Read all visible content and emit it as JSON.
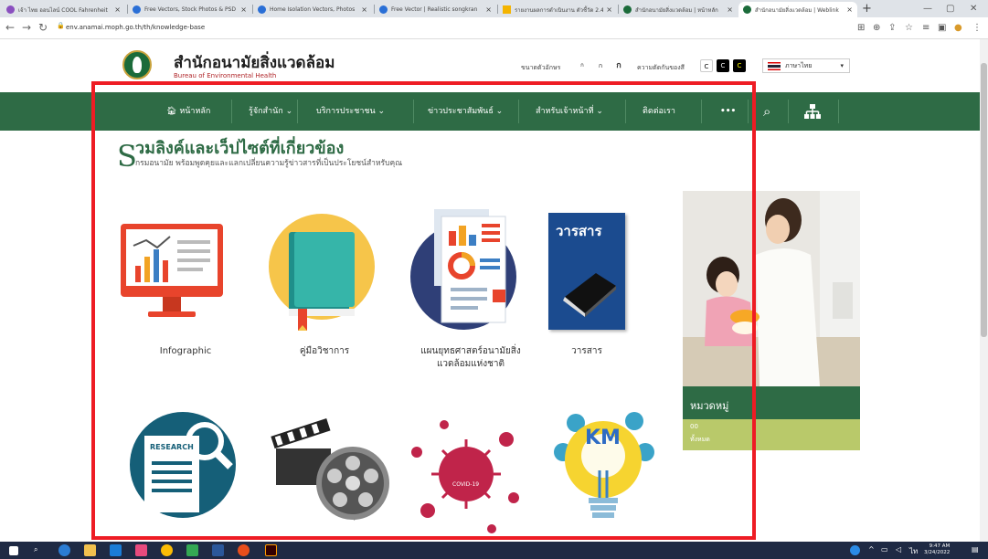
{
  "browser": {
    "tabs": [
      {
        "title": "เจ้า ไทย ออนไลน์ COOL Fahrenheit",
        "favicon_color": "#8a4fbf"
      },
      {
        "title": "Free Vectors, Stock Photos & PSD",
        "favicon_color": "#2a6fd6"
      },
      {
        "title": "Home Isolation Vectors, Photos",
        "favicon_color": "#2a6fd6"
      },
      {
        "title": "Free Vector | Realistic songkran",
        "favicon_color": "#2a6fd6"
      },
      {
        "title": "รายงานผลการดำเนินงาน ตัวชี้วัด 2.4",
        "favicon_color": "#f4b400"
      },
      {
        "title": "สำนักอนามัยสิ่งแวดล้อม | หน้าหลัก",
        "favicon_color": "#1b6b3a"
      },
      {
        "title": "สำนักอนามัยสิ่งแวดล้อม | Weblink",
        "favicon_color": "#1b6b3a"
      }
    ],
    "new_tab": "+",
    "url": "env.anamai.moph.go.th/th/knowledge-base"
  },
  "site": {
    "title": "สำนักอนามัยสิ่งแวดล้อม",
    "subtitle": "Bureau of Environmental Health",
    "font_size_label": "ขนาดตัวอักษร",
    "font_sizes": [
      "ก",
      "ก",
      "ก"
    ],
    "contrast_label": "ความตัดกันของสี",
    "contrast_options": [
      "C",
      "C",
      "C"
    ],
    "language": "ภาษาไทย"
  },
  "nav": {
    "items": [
      {
        "label": "หน้าหลัก",
        "icon": "home-icon"
      },
      {
        "label": "รู้จักสำนัก ⌄"
      },
      {
        "label": "บริการประชาชน ⌄"
      },
      {
        "label": "ข่าวประชาสัมพันธ์ ⌄"
      },
      {
        "label": "สำหรับเจ้าหน้าที่ ⌄"
      },
      {
        "label": "ติดต่อเรา"
      },
      {
        "label": "•••"
      }
    ]
  },
  "section": {
    "letter": "S",
    "title": "วมลิงค์และเว็ปไซต์ที่เกี่ยวข้อง",
    "subtitle": "กรมอนามัย พร้อมพูดคุยและแลกเปลี่ยนความรู้ข่าวสารที่เป็นประโยชน์สำหรับคุณ"
  },
  "tiles": [
    {
      "label": "Infographic",
      "icon": "infographic-monitor-icon"
    },
    {
      "label": "คู่มือวิชาการ",
      "icon": "handbook-book-icon"
    },
    {
      "label": "แผนยุทธศาสตร์อนามัยสิ่งแวดล้อมแห่งชาติ",
      "icon": "strategy-report-icon"
    },
    {
      "label": "วารสาร",
      "icon": "journal-icon",
      "cover_text": "วารสาร"
    },
    {
      "label": "",
      "icon": "research-icon",
      "cover_text": "RESEARCH"
    },
    {
      "label": "",
      "icon": "film-video-icon"
    },
    {
      "label": "",
      "icon": "covid-virus-icon",
      "cover_text": "COVID-19"
    },
    {
      "label": "",
      "icon": "km-lightbulb-icon",
      "cover_text": "KM"
    }
  ],
  "sidebar": {
    "category_title": "หมวดหมู่",
    "item_count": "00",
    "item_label": "ทั้งหมด"
  },
  "taskbar": {
    "time": "9:47 AM",
    "date": "3/24/2022"
  },
  "colors": {
    "brand_green": "#2e6b45",
    "highlight_red": "#ee1c24",
    "sidebar_olive": "#b9c96a"
  }
}
